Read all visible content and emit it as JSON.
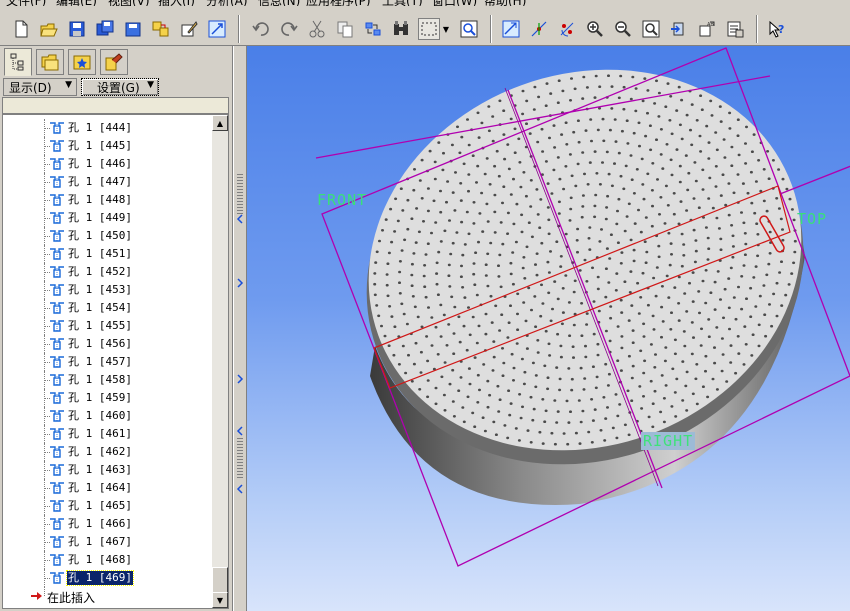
{
  "menubar": {
    "items": [
      "文件(F)",
      "编辑(E)",
      "视图(V)",
      "插入(I)",
      "分析(A)",
      "信息(N)",
      "应用程序(P)",
      "工具(T)",
      "窗口(W)",
      "帮助(H)"
    ]
  },
  "toolbar": {
    "buttons": [
      {
        "name": "new-icon"
      },
      {
        "name": "open-icon"
      },
      {
        "name": "save-icon"
      },
      {
        "name": "save-copy-icon"
      },
      {
        "name": "backup-icon"
      },
      {
        "name": "rename-icon"
      },
      {
        "name": "edit-icon"
      },
      {
        "name": "regenerate-icon"
      },
      {
        "name": "undo-icon"
      },
      {
        "name": "redo-icon"
      },
      {
        "name": "cut-icon"
      },
      {
        "name": "copy-icon"
      },
      {
        "name": "paste-special-icon"
      },
      {
        "name": "find-icon"
      },
      {
        "name": "select-box-icon"
      },
      {
        "name": "zoom-window-icon"
      },
      {
        "name": "datum-plane-icon"
      },
      {
        "name": "datum-axis-icon"
      },
      {
        "name": "datum-point-icon"
      },
      {
        "name": "zoom-in-icon"
      },
      {
        "name": "zoom-out-icon"
      },
      {
        "name": "refit-icon"
      },
      {
        "name": "orient-icon"
      },
      {
        "name": "views-icon"
      },
      {
        "name": "layers-icon"
      },
      {
        "name": "context-help-icon"
      }
    ]
  },
  "left_panel": {
    "tabs": [
      {
        "name": "model-tree-tab-icon",
        "active": true
      },
      {
        "name": "folder-browser-tab-icon",
        "active": false
      },
      {
        "name": "favorites-tab-icon",
        "active": false
      },
      {
        "name": "connections-tab-icon",
        "active": false
      }
    ],
    "display_dropdown": "显示(D)",
    "settings_dropdown": "设置(G)",
    "tree_items": [
      "孔 1 [444]",
      "孔 1 [445]",
      "孔 1 [446]",
      "孔 1 [447]",
      "孔 1 [448]",
      "孔 1 [449]",
      "孔 1 [450]",
      "孔 1 [451]",
      "孔 1 [452]",
      "孔 1 [453]",
      "孔 1 [454]",
      "孔 1 [455]",
      "孔 1 [456]",
      "孔 1 [457]",
      "孔 1 [458]",
      "孔 1 [459]",
      "孔 1 [460]",
      "孔 1 [461]",
      "孔 1 [462]",
      "孔 1 [463]",
      "孔 1 [464]",
      "孔 1 [465]",
      "孔 1 [466]",
      "孔 1 [467]",
      "孔 1 [468]",
      "孔 1 [469]"
    ],
    "selected_item": "孔 1 [469]",
    "insert_here": "在此插入"
  },
  "viewport": {
    "datum_labels": {
      "front": "FRONT",
      "top": "TOP",
      "right": "RIGHT"
    },
    "colors": {
      "background_top": "#4a7fe8",
      "background_bottom": "#d8e4fb",
      "part_face": "#dcdcdc",
      "datum_plane": "#b000b0",
      "selected_hole_axes": "#d01818",
      "datum_text": "#39e07a"
    }
  }
}
